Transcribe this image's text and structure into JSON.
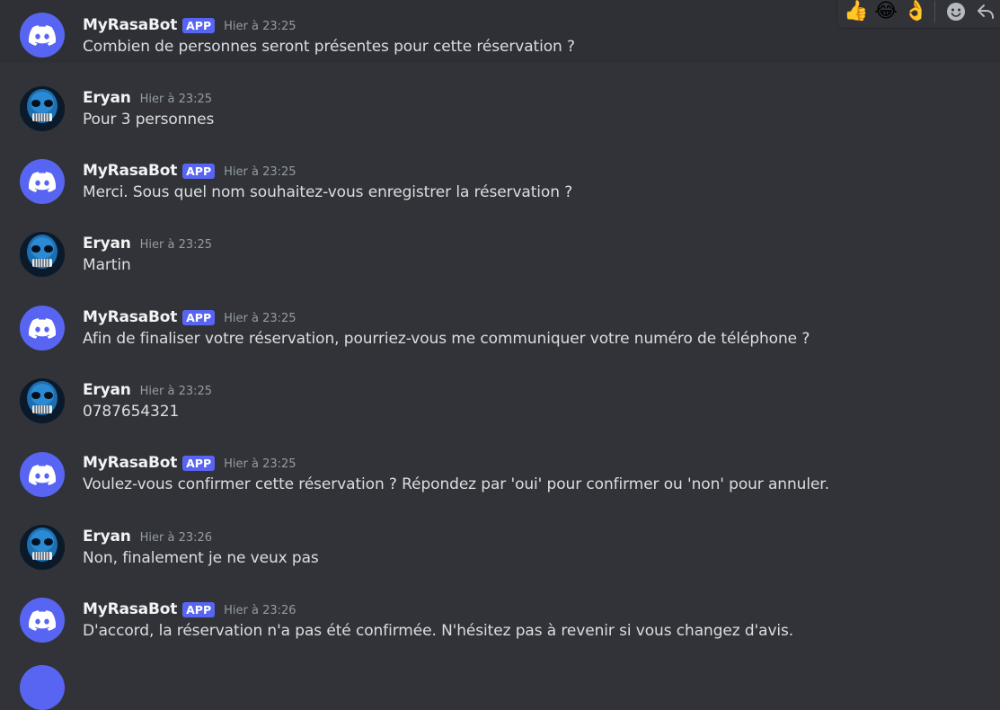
{
  "toolbar": {
    "reactions": [
      "👍",
      "😂",
      "👌"
    ],
    "icons": [
      "add-reaction-icon",
      "reply-icon"
    ]
  },
  "messages": [
    {
      "author": "MyRasaBot",
      "is_bot": true,
      "tag": "APP",
      "time": "Hier à 23:25",
      "text": "Combien de personnes seront présentes pour cette réservation ?"
    },
    {
      "author": "Eryan",
      "is_bot": false,
      "time": "Hier à 23:25",
      "text": "Pour 3 personnes"
    },
    {
      "author": "MyRasaBot",
      "is_bot": true,
      "tag": "APP",
      "time": "Hier à 23:25",
      "text": "Merci. Sous quel nom souhaitez-vous enregistrer la réservation ?"
    },
    {
      "author": "Eryan",
      "is_bot": false,
      "time": "Hier à 23:25",
      "text": "Martin"
    },
    {
      "author": "MyRasaBot",
      "is_bot": true,
      "tag": "APP",
      "time": "Hier à 23:25",
      "text": "Afin de finaliser votre réservation, pourriez-vous me communiquer votre numéro de téléphone ?"
    },
    {
      "author": "Eryan",
      "is_bot": false,
      "time": "Hier à 23:25",
      "text": "0787654321"
    },
    {
      "author": "MyRasaBot",
      "is_bot": true,
      "tag": "APP",
      "time": "Hier à 23:25",
      "text": "Voulez-vous confirmer cette réservation ? Répondez par 'oui' pour confirmer ou 'non' pour annuler."
    },
    {
      "author": "Eryan",
      "is_bot": false,
      "time": "Hier à 23:26",
      "text": "Non, finalement je ne veux pas"
    },
    {
      "author": "MyRasaBot",
      "is_bot": true,
      "tag": "APP",
      "time": "Hier à 23:26",
      "text": "D'accord, la réservation n'a pas été confirmée. N'hésitez pas à revenir si vous changez d'avis."
    }
  ]
}
